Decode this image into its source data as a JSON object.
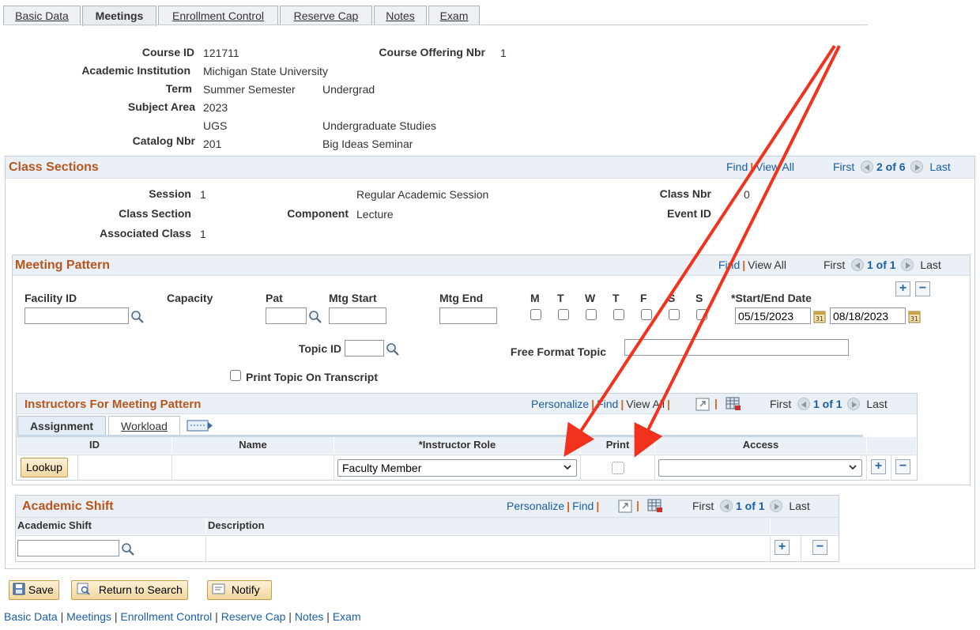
{
  "tabs": [
    {
      "label": "Basic Data",
      "active": false
    },
    {
      "label": "Meetings",
      "active": true
    },
    {
      "label": "Enrollment Control",
      "active": false
    },
    {
      "label": "Reserve Cap",
      "active": false
    },
    {
      "label": "Notes",
      "active": false
    },
    {
      "label": "Exam",
      "active": false
    }
  ],
  "course": {
    "course_id_label": "Course ID",
    "course_id": "121711",
    "offering_label": "Course Offering Nbr",
    "offering": "1",
    "institution_label": "Academic Institution",
    "institution": "Michigan State University",
    "term_label": "Term",
    "term": "Summer Semester",
    "term_career": "Undergrad",
    "subject_label": "Subject Area",
    "subject_year": "2023",
    "subject_code": "UGS",
    "subject_desc": "Undergraduate Studies",
    "catalog_label": "Catalog Nbr",
    "catalog_nbr": "201",
    "catalog_desc": "Big Ideas Seminar"
  },
  "class_sections": {
    "title": "Class Sections",
    "find": "Find",
    "view_all": "View All",
    "first": "First",
    "count": "2 of 6",
    "last": "Last",
    "session_label": "Session",
    "session": "1",
    "session_desc": "Regular Academic Session",
    "class_nbr_label": "Class Nbr",
    "class_nbr": "0",
    "class_section_label": "Class Section",
    "component_label": "Component",
    "component": "Lecture",
    "event_id_label": "Event ID",
    "assoc_label": "Associated Class",
    "assoc": "1"
  },
  "meeting_pattern": {
    "title": "Meeting Pattern",
    "find": "Find",
    "view_all": "View All",
    "first": "First",
    "count": "1 of 1",
    "last": "Last",
    "facility_label": "Facility ID",
    "capacity_label": "Capacity",
    "pat_label": "Pat",
    "mtg_start_label": "Mtg Start",
    "mtg_end_label": "Mtg End",
    "days": [
      "M",
      "T",
      "W",
      "T",
      "F",
      "S",
      "S"
    ],
    "date_label": "*Start/End Date",
    "start_date": "05/15/2023",
    "end_date": "08/18/2023",
    "topic_label": "Topic ID",
    "free_topic_label": "Free Format Topic",
    "print_topic_label": "Print Topic On Transcript"
  },
  "instructors": {
    "title": "Instructors For Meeting Pattern",
    "personalize": "Personalize",
    "find": "Find",
    "view_all": "View All",
    "first": "First",
    "count": "1 of 1",
    "last": "Last",
    "tab_assignment": "Assignment",
    "tab_workload": "Workload",
    "col_id": "ID",
    "col_name": "Name",
    "col_role": "*Instructor Role",
    "col_print": "Print",
    "col_access": "Access",
    "lookup": "Lookup",
    "role_value": "Faculty Member",
    "access_value": ""
  },
  "academic_shift": {
    "title": "Academic Shift",
    "personalize": "Personalize",
    "find": "Find",
    "first": "First",
    "count": "1 of 1",
    "last": "Last",
    "col_shift": "Academic Shift",
    "col_desc": "Description"
  },
  "buttons": {
    "save": "Save",
    "return": "Return to Search",
    "notify": "Notify"
  },
  "footer_links": [
    "Basic Data",
    "Meetings",
    "Enrollment Control",
    "Reserve Cap",
    "Notes",
    "Exam"
  ],
  "colors": {
    "section_title": "#b8561c",
    "link": "#1a5ea8",
    "annotation_arrow": "#f2321c"
  }
}
